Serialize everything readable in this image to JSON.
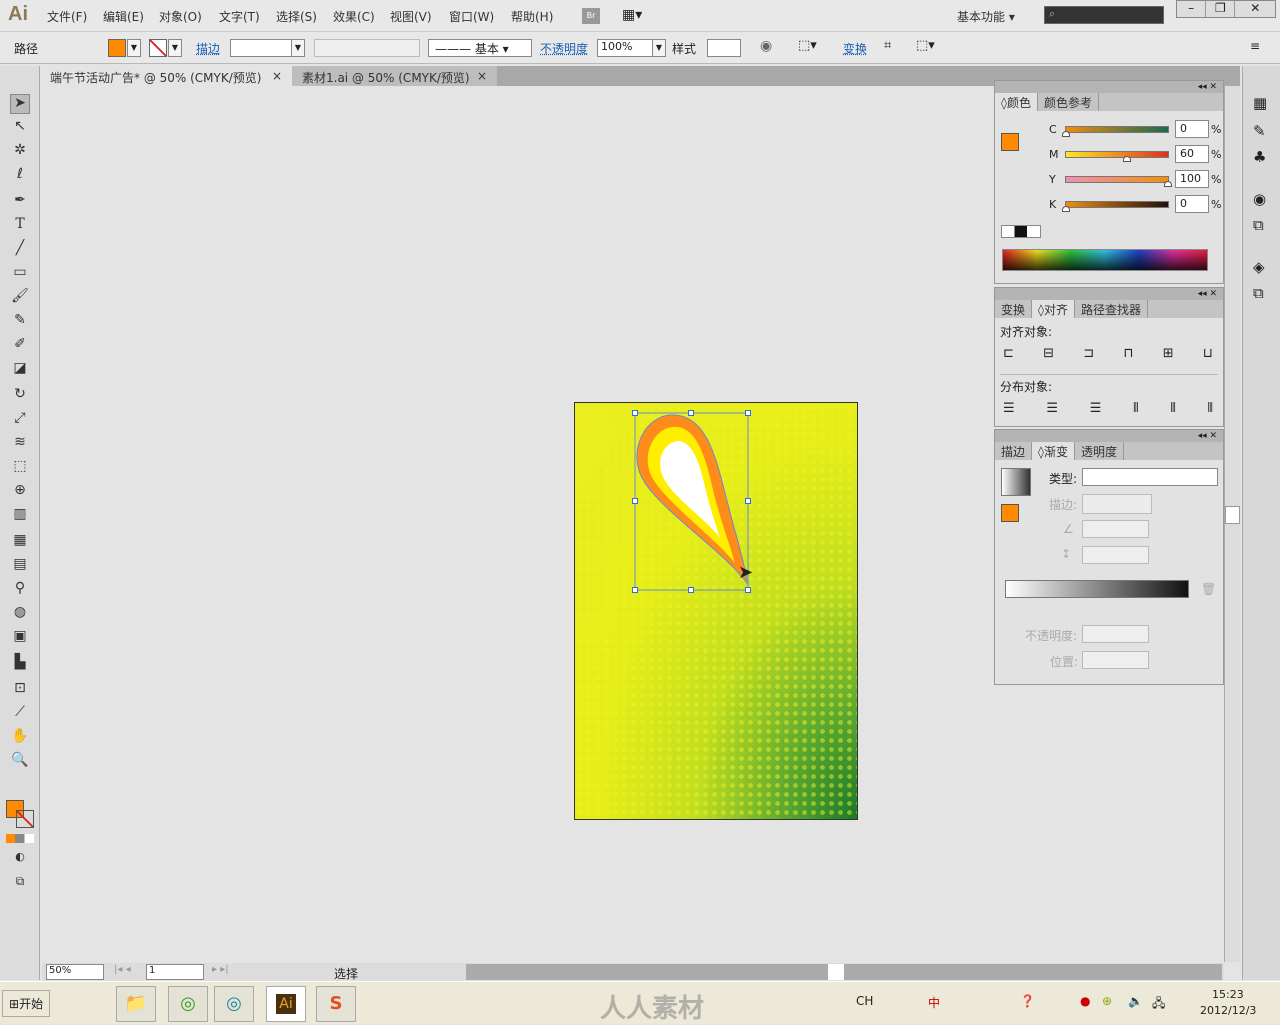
{
  "app": {
    "logo": "Ai",
    "menus": [
      "文件(F)",
      "编辑(E)",
      "对象(O)",
      "文字(T)",
      "选择(S)",
      "效果(C)",
      "视图(V)",
      "窗口(W)",
      "帮助(H)"
    ],
    "bridge": "Br",
    "workspace": "基本功能",
    "search_placeholder": ""
  },
  "control": {
    "object_type": "路径",
    "fill_color": "#ff8c00",
    "stroke_label": "描边",
    "stroke_style": "基本",
    "opacity_label": "不透明度",
    "opacity": "100%",
    "style_label": "样式",
    "transform_label": "变换"
  },
  "tabs": [
    {
      "label": "端午节活动广告* @ 50% (CMYK/预览)",
      "close": "×"
    },
    {
      "label": "素材1.ai @ 50% (CMYK/预览)",
      "close": "×"
    }
  ],
  "color_panel": {
    "tabs": [
      "颜色",
      "颜色参考"
    ],
    "channels": [
      {
        "name": "C",
        "value": "0"
      },
      {
        "name": "M",
        "value": "60"
      },
      {
        "name": "Y",
        "value": "100"
      },
      {
        "name": "K",
        "value": "0"
      }
    ],
    "unit": "%"
  },
  "align_panel": {
    "tabs": [
      "变换",
      "对齐",
      "路径查找器"
    ],
    "align_label": "对齐对象:",
    "distribute_label": "分布对象:"
  },
  "gradient_panel": {
    "tabs": [
      "描边",
      "渐变",
      "透明度"
    ],
    "type_label": "类型:",
    "type_value": "",
    "stroke_label": "描边:",
    "opacity_label": "不透明度:",
    "position_label": "位置:"
  },
  "status": {
    "zoom": "50%",
    "page": "1",
    "tool": "选择"
  },
  "taskbar": {
    "start": "开始",
    "watermark": "人人素材",
    "lang": "CH",
    "ime": "中",
    "time": "15:23",
    "date": "2012/12/3"
  }
}
